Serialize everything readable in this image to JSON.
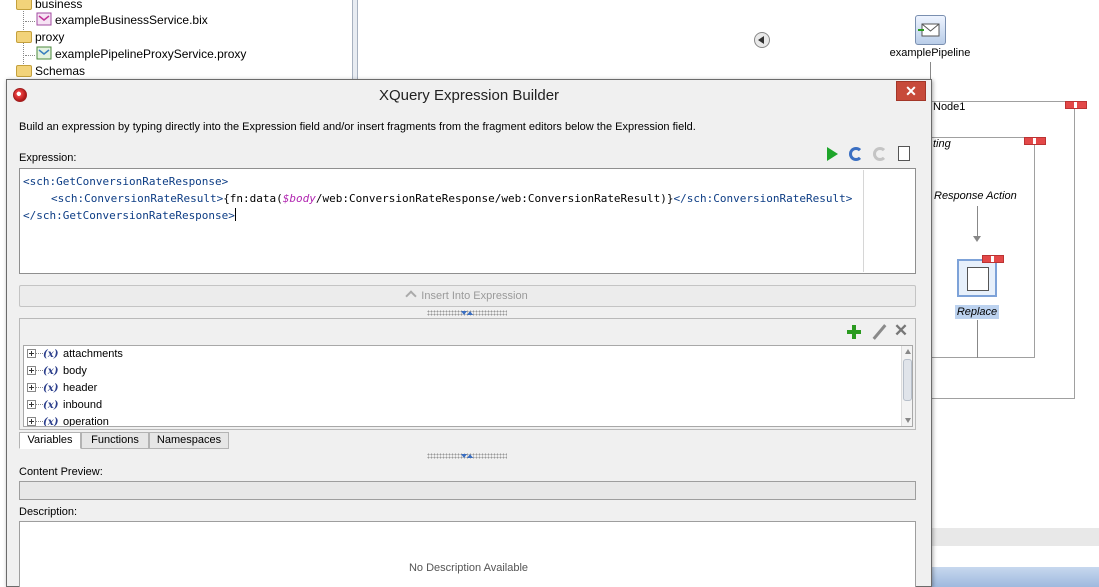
{
  "project_tree": {
    "items": [
      {
        "label": "business",
        "type": "folder"
      },
      {
        "label": "exampleBusinessService.bix",
        "type": "business-service"
      },
      {
        "label": "proxy",
        "type": "folder"
      },
      {
        "label": "examplePipelineProxyService.proxy",
        "type": "proxy-service"
      },
      {
        "label": "Schemas",
        "type": "folder"
      }
    ]
  },
  "canvas": {
    "pipeline_label": "examplePipeline",
    "node_label": "Node1",
    "stage_label": "ting",
    "action_label": "Response Action",
    "replace_label": "Replace"
  },
  "dialog": {
    "title": "XQuery Expression Builder",
    "close_label": "✕",
    "intro": "Build an expression by typing directly into the Expression field and/or insert fragments from the fragment editors below the Expression field.",
    "expression_label": "Expression:",
    "expression_lines": {
      "l1_open": "<sch:GetConversionRateResponse>",
      "l2_open": "<sch:ConversionRateResult>",
      "l2_fn_open": "{fn:data(",
      "l2_var": "$body",
      "l2_path": "/web:ConversionRateResponse/web:ConversionRateResult)}",
      "l2_close": "</sch:ConversionRateResult>",
      "l3_close": "</sch:GetConversionRateResponse>"
    },
    "insert_button": "Insert Into Expression",
    "variables": [
      {
        "label": "attachments"
      },
      {
        "label": "body"
      },
      {
        "label": "header"
      },
      {
        "label": "inbound"
      },
      {
        "label": "operation"
      }
    ],
    "variable_icon": "(x)",
    "tabs": [
      {
        "label": "Variables",
        "active": true
      },
      {
        "label": "Functions",
        "active": false
      },
      {
        "label": "Namespaces",
        "active": false
      }
    ],
    "content_preview_label": "Content Preview:",
    "description_label": "Description:",
    "description_text": "No Description Available"
  },
  "colors": {
    "accent": "#3a6fc2",
    "close_button": "#c74a3a",
    "xml_tag": "#0d3d85",
    "xml_variable": "#b126b1",
    "run_green": "#1ea52a"
  }
}
